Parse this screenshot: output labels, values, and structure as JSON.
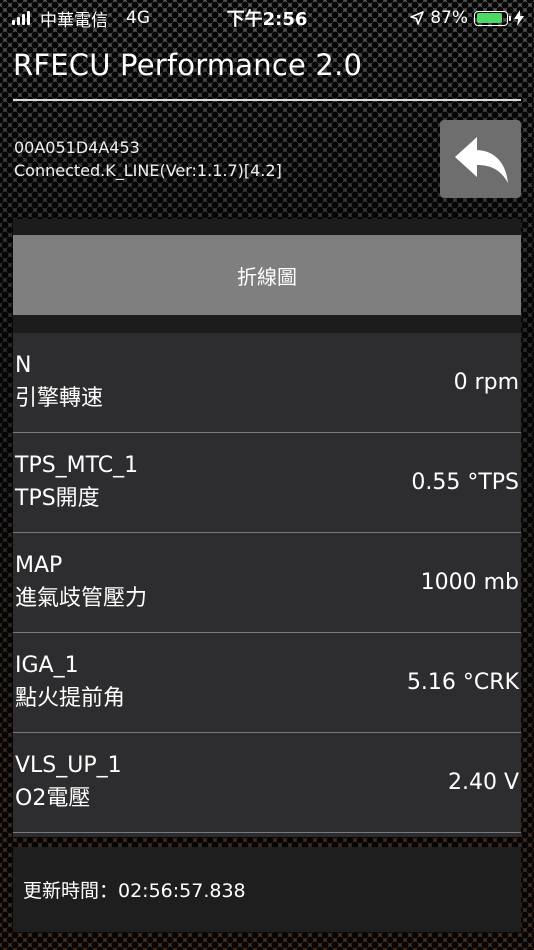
{
  "status_bar": {
    "carrier": "中華電信",
    "network": "4G",
    "time": "下午2:56",
    "battery_percent": "87%",
    "battery_level": 0.87,
    "location_icon": "location-arrow-icon",
    "charging_icon": "bolt-icon"
  },
  "header": {
    "title": "RFECU Performance 2.0",
    "device_id": "00A051D4A453",
    "connection": "Connected.K_LINE(Ver:1.1.7)[4.2]",
    "back_icon": "reply-arrow-icon"
  },
  "chart_button": {
    "label": "折線圖"
  },
  "readings": [
    {
      "code": "N",
      "label": "引擎轉速",
      "value": "0 rpm"
    },
    {
      "code": "TPS_MTC_1",
      "label": "TPS開度",
      "value": "0.55 °TPS"
    },
    {
      "code": "MAP",
      "label": "進氣歧管壓力",
      "value": "1000 mb"
    },
    {
      "code": "IGA_1",
      "label": "點火提前角",
      "value": "5.16 °CRK"
    },
    {
      "code": "VLS_UP_1",
      "label": "O2電壓",
      "value": "2.40 V"
    }
  ],
  "footer": {
    "update_time": "更新時間：02:56:57.838"
  },
  "colors": {
    "battery": "#4cd964",
    "panel": "#2d2d2f",
    "button": "#7f7f7f"
  }
}
